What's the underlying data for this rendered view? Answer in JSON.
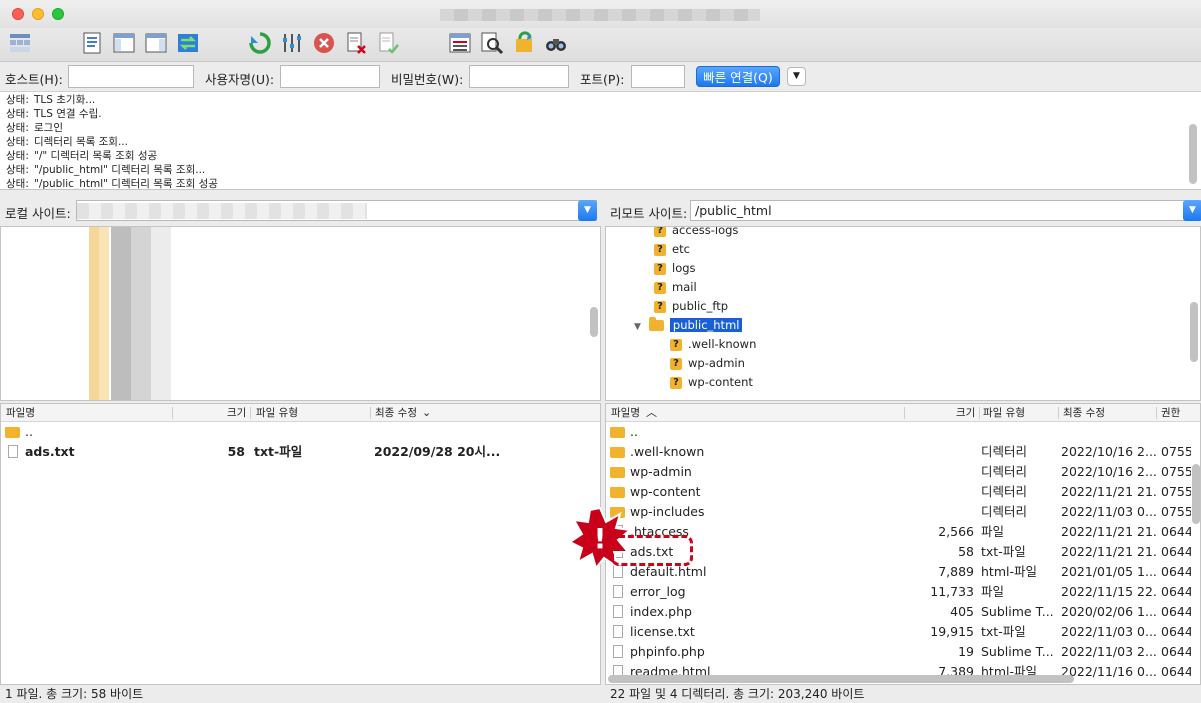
{
  "toolbar": {
    "icons": [
      "site-manager-icon",
      "log-toggle-icon",
      "tree-toggle-icon",
      "remote-tree-toggle-icon",
      "transfer-queue-icon",
      "refresh-icon",
      "process-queue-icon",
      "cancel-icon",
      "disconnect-icon",
      "reconnect-icon",
      "directory-filter-icon",
      "search-icon",
      "sync-browse-icon",
      "find-files-icon"
    ]
  },
  "quickconnect": {
    "host_label": "호스트(H):",
    "user_label": "사용자명(U):",
    "pass_label": "비밀번호(W):",
    "port_label": "포트(P):",
    "connect_label": "빠른 연결(Q)",
    "host_value": "",
    "user_value": "",
    "pass_value": "",
    "port_value": ""
  },
  "log": [
    {
      "label": "상태:",
      "text": "TLS 초기화..."
    },
    {
      "label": "상태:",
      "text": "TLS 연결 수립."
    },
    {
      "label": "상태:",
      "text": "로그인"
    },
    {
      "label": "상태:",
      "text": "디렉터리 목록 조회..."
    },
    {
      "label": "상태:",
      "text": "\"/\" 디렉터리 목록 조회 성공"
    },
    {
      "label": "상태:",
      "text": "\"/public_html\" 디렉터리 목록 조회..."
    },
    {
      "label": "상태:",
      "text": "\"/public_html\" 디렉터리 목록 조회 성공"
    }
  ],
  "local": {
    "site_label": "로컬 사이트:",
    "site_path": "",
    "headers": {
      "name": "파일명",
      "size": "크기",
      "type": "파일 유형",
      "modified": "최종 수정"
    },
    "files": [
      {
        "name": "..",
        "size": "",
        "type": "",
        "modified": "",
        "kind": "folder"
      },
      {
        "name": "ads.txt",
        "size": "58",
        "type": "txt-파일",
        "modified": "2022/09/28 20시...",
        "kind": "file"
      }
    ],
    "status": "1 파일. 총 크기: 58 바이트"
  },
  "remote": {
    "site_label": "리모트 사이트:",
    "site_path": "/public_html",
    "tree": [
      {
        "name": "access-logs",
        "kind": "unknown"
      },
      {
        "name": "etc",
        "kind": "unknown"
      },
      {
        "name": "logs",
        "kind": "unknown"
      },
      {
        "name": "mail",
        "kind": "unknown"
      },
      {
        "name": "public_ftp",
        "kind": "unknown"
      },
      {
        "name": "public_html",
        "kind": "folder-open"
      },
      {
        "name": ".well-known",
        "kind": "unknown"
      },
      {
        "name": "wp-admin",
        "kind": "unknown"
      },
      {
        "name": "wp-content",
        "kind": "unknown"
      }
    ],
    "headers": {
      "name": "파일명",
      "size": "크기",
      "type": "파일 유형",
      "modified": "최종 수정",
      "perm": "권한"
    },
    "files": [
      {
        "name": "..",
        "size": "",
        "type": "",
        "modified": "",
        "perm": "",
        "kind": "folder"
      },
      {
        "name": ".well-known",
        "size": "",
        "type": "디렉터리",
        "modified": "2022/10/16 2...",
        "perm": "0755",
        "kind": "folder"
      },
      {
        "name": "wp-admin",
        "size": "",
        "type": "디렉터리",
        "modified": "2022/10/16 2...",
        "perm": "0755",
        "kind": "folder"
      },
      {
        "name": "wp-content",
        "size": "",
        "type": "디렉터리",
        "modified": "2022/11/21 21...",
        "perm": "0755",
        "kind": "folder"
      },
      {
        "name": "wp-includes",
        "size": "",
        "type": "디렉터리",
        "modified": "2022/11/03 0...",
        "perm": "0755",
        "kind": "folder"
      },
      {
        "name": ".htaccess",
        "size": "2,566",
        "type": "파일",
        "modified": "2022/11/21 21...",
        "perm": "0644",
        "kind": "file"
      },
      {
        "name": "ads.txt",
        "size": "58",
        "type": "txt-파일",
        "modified": "2022/11/21 21...",
        "perm": "0644",
        "kind": "file"
      },
      {
        "name": "default.html",
        "size": "7,889",
        "type": "html-파일",
        "modified": "2021/01/05 1...",
        "perm": "0644",
        "kind": "file"
      },
      {
        "name": "error_log",
        "size": "11,733",
        "type": "파일",
        "modified": "2022/11/15 22...",
        "perm": "0644",
        "kind": "file"
      },
      {
        "name": "index.php",
        "size": "405",
        "type": "Sublime T...",
        "modified": "2020/02/06 1...",
        "perm": "0644",
        "kind": "file"
      },
      {
        "name": "license.txt",
        "size": "19,915",
        "type": "txt-파일",
        "modified": "2022/11/03 0...",
        "perm": "0644",
        "kind": "file"
      },
      {
        "name": "phpinfo.php",
        "size": "19",
        "type": "Sublime T...",
        "modified": "2022/11/03 2...",
        "perm": "0644",
        "kind": "file"
      },
      {
        "name": "readme.html",
        "size": "7,389",
        "type": "html-파일",
        "modified": "2022/11/16 0...",
        "perm": "0644",
        "kind": "file"
      }
    ],
    "status": "22 파일 및 4 디렉터리. 총 크기: 203,240 바이트"
  },
  "annotation": {
    "symbol": "!",
    "color": "#d0021b"
  }
}
